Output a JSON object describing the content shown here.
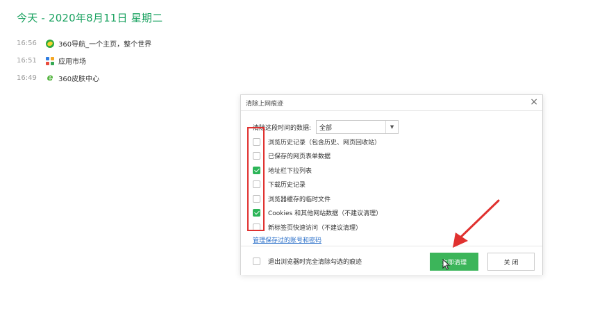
{
  "heading": "今天 - 2020年8月11日 星期二",
  "history": [
    {
      "time": "16:56",
      "title": "360导航_一个主页，整个世界",
      "icon": "globe-icon"
    },
    {
      "time": "16:51",
      "title": "应用市场",
      "icon": "app-grid-icon"
    },
    {
      "time": "16:49",
      "title": "360皮肤中心",
      "icon": "skin-e-icon"
    }
  ],
  "dialog": {
    "title": "清除上网痕迹",
    "close_symbol": "×",
    "range_label": "清除这段时间的数据:",
    "range_value": "全部",
    "range_arrow": "▼",
    "options": [
      {
        "label": "浏览历史记录（包含历史、网页回收站）",
        "checked": false
      },
      {
        "label": "已保存的网页表单数据",
        "checked": false
      },
      {
        "label": "地址栏下拉列表",
        "checked": true
      },
      {
        "label": "下载历史记录",
        "checked": false
      },
      {
        "label": "浏览器缓存的临时文件",
        "checked": false
      },
      {
        "label": "Cookies 和其他网站数据（不建议清理）",
        "checked": true
      },
      {
        "label": "新标签页快速访问（不建议清理）",
        "checked": false
      }
    ],
    "manage_link": "管理保存过的账号和密码",
    "exit_option": {
      "label": "退出浏览器时完全清除勾选的痕迹",
      "checked": false
    },
    "primary_button": "立即清理",
    "secondary_button": "关 闭"
  },
  "colors": {
    "accent_green": "#3cb55a",
    "heading_green": "#1aa260",
    "annotation_red": "#e0312f",
    "link_blue": "#2a6fc9"
  }
}
